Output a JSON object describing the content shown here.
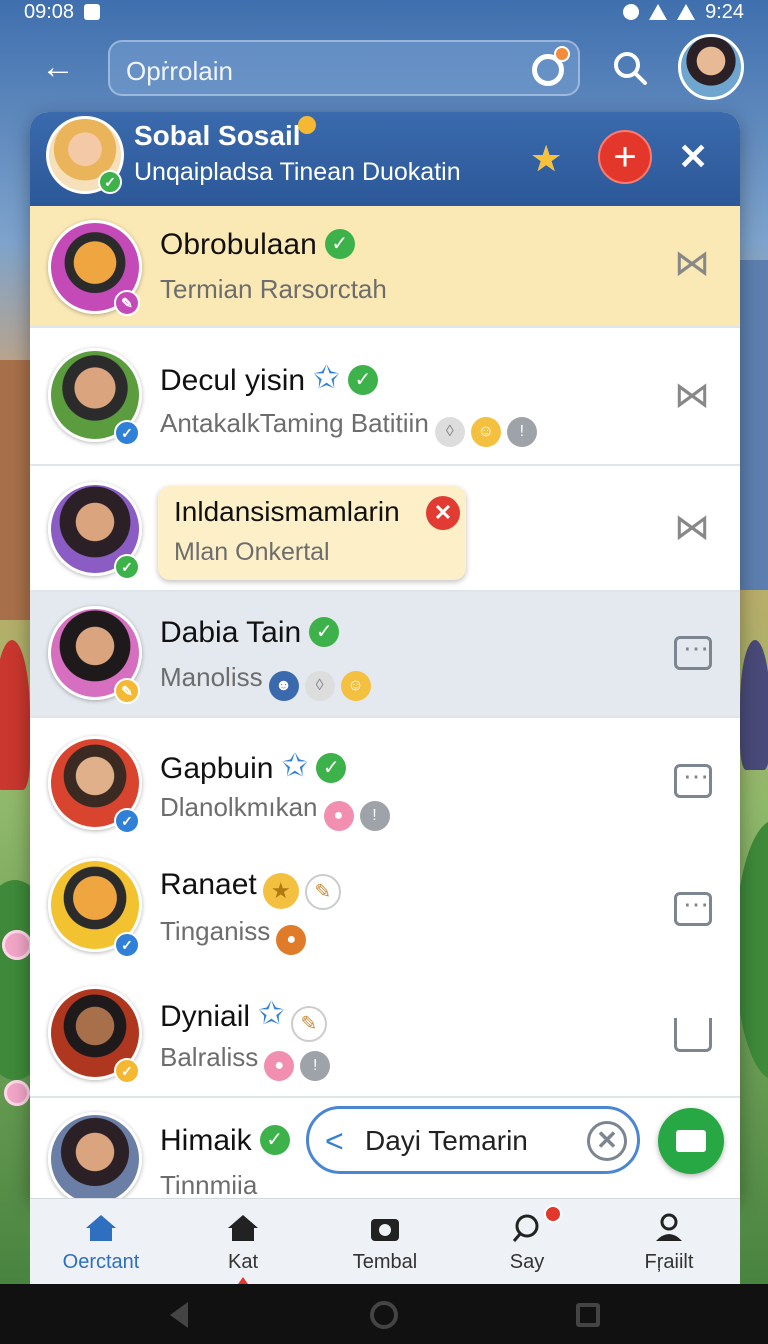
{
  "status_bar": {
    "time_left": "09:08",
    "time_right": "9:24"
  },
  "search": {
    "placeholder": "Opṙrolain"
  },
  "header": {
    "title": "Sobal Sosail",
    "subtitle": "Unqaipladsa Tinean Duokatin"
  },
  "chats": [
    {
      "name": "Obrobulaan",
      "preview": "Termian Rarsorctah"
    },
    {
      "name": "Decul yisin",
      "preview": "AntakalkTaming Batitiin"
    },
    {
      "name": "Inldansismamlarin",
      "preview": "Mlan Onkertal"
    },
    {
      "name": "Dabia Tain",
      "preview": "Manoliss"
    },
    {
      "name": "Gapbuin",
      "preview": "Dlanolkmıkan"
    },
    {
      "name": "Ranaet",
      "preview": "Tinganiss"
    },
    {
      "name": "Dyniail",
      "preview": "Balraliss"
    },
    {
      "name": "Himaik",
      "preview": "Tinnmiia"
    }
  ],
  "compose": {
    "text": "Dayi Temarin"
  },
  "bottom_nav": [
    {
      "label": "Oerctant",
      "icon": "home-icon",
      "active": true
    },
    {
      "label": "Kat",
      "icon": "house-icon",
      "active": false
    },
    {
      "label": "Tembal",
      "icon": "camera-icon",
      "active": false
    },
    {
      "label": "Say",
      "icon": "search-icon",
      "active": false
    },
    {
      "label": "Fŗaiilt",
      "icon": "person-icon",
      "active": false
    }
  ],
  "colors": {
    "header_blue": "#2c5898",
    "highlight_yellow": "#fbe9b5",
    "verified_green": "#3db24a",
    "accent_red": "#e4372b",
    "nav_active": "#2f6fbf"
  }
}
